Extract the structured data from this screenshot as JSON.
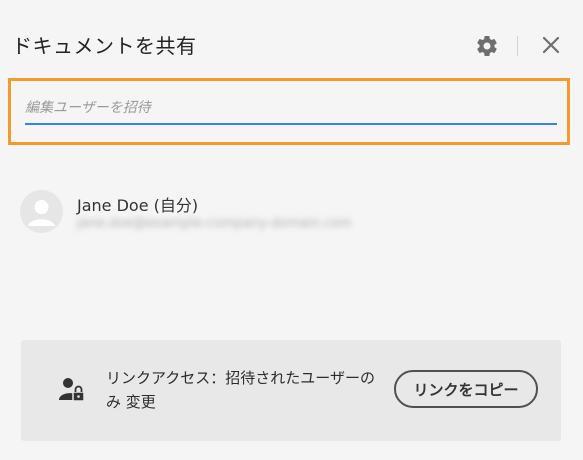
{
  "dialog": {
    "title": "ドキュメントを共有",
    "settings_icon": "gear-icon",
    "close_icon": "close-icon"
  },
  "invite": {
    "placeholder": "編集ユーザーを招待",
    "highlight_color": "#f29a2e",
    "underline_color": "#3b82e8"
  },
  "users": [
    {
      "name": "Jane Doe (自分)",
      "email": "jane.doe@example-company-domain.com",
      "avatar_icon": "user-avatar-icon"
    }
  ],
  "link_access": {
    "icon": "user-lock-icon",
    "text": "リンクアクセス：招待されたユーザーのみ 変更",
    "copy_button_label": "リンクをコピー"
  }
}
